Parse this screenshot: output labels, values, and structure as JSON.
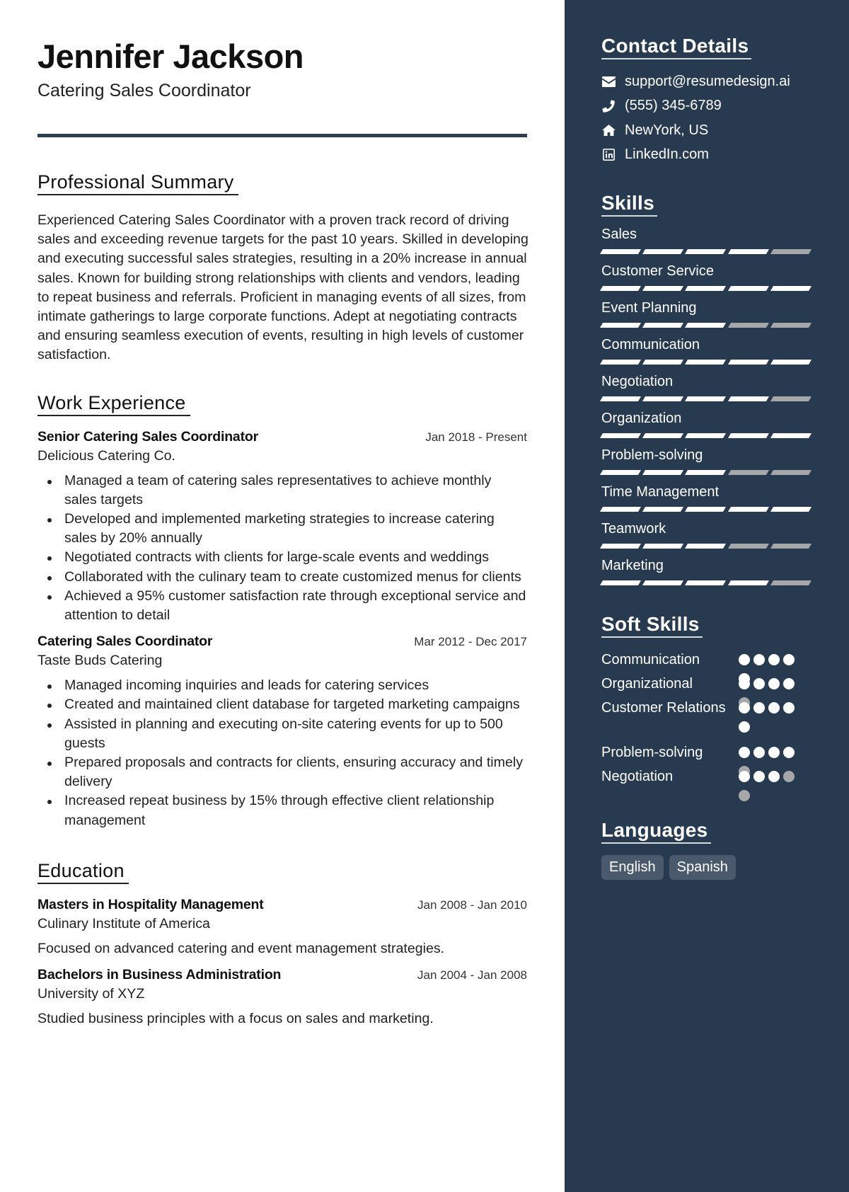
{
  "header": {
    "name": "Jennifer Jackson",
    "role": "Catering Sales Coordinator"
  },
  "summary": {
    "title": "Professional Summary",
    "text": "Experienced Catering Sales Coordinator with a proven track record of driving sales and exceeding revenue targets for the past 10 years. Skilled in developing and executing successful sales strategies, resulting in a 20% increase in annual sales. Known for building strong relationships with clients and vendors, leading to repeat business and referrals. Proficient in managing events of all sizes, from intimate gatherings to large corporate functions. Adept at negotiating contracts and ensuring seamless execution of events, resulting in high levels of customer satisfaction."
  },
  "work": {
    "title": "Work Experience",
    "jobs": [
      {
        "title": "Senior Catering Sales Coordinator",
        "dates": "Jan 2018 - Present",
        "company": "Delicious Catering Co.",
        "bullets": [
          "Managed a team of catering sales representatives to achieve monthly sales targets",
          "Developed and implemented marketing strategies to increase catering sales by 20% annually",
          "Negotiated contracts with clients for large-scale events and weddings",
          "Collaborated with the culinary team to create customized menus for clients",
          "Achieved a 95% customer satisfaction rate through exceptional service and attention to detail"
        ]
      },
      {
        "title": "Catering Sales Coordinator",
        "dates": "Mar 2012 - Dec 2017",
        "company": "Taste Buds Catering",
        "bullets": [
          "Managed incoming inquiries and leads for catering services",
          "Created and maintained client database for targeted marketing campaigns",
          "Assisted in planning and executing on-site catering events for up to 500 guests",
          "Prepared proposals and contracts for clients, ensuring accuracy and timely delivery",
          "Increased repeat business by 15% through effective client relationship management"
        ]
      }
    ]
  },
  "education": {
    "title": "Education",
    "items": [
      {
        "degree": "Masters in Hospitality Management",
        "dates": "Jan 2008 - Jan 2010",
        "school": "Culinary Institute of America",
        "desc": "Focused on advanced catering and event management strategies."
      },
      {
        "degree": "Bachelors in Business Administration",
        "dates": "Jan 2004 - Jan 2008",
        "school": "University of XYZ",
        "desc": "Studied business principles with a focus on sales and marketing."
      }
    ]
  },
  "contact": {
    "title": "Contact Details",
    "items": [
      {
        "icon": "envelope-icon",
        "text": "support@resumedesign.ai"
      },
      {
        "icon": "phone-icon",
        "text": "(555) 345-6789"
      },
      {
        "icon": "home-icon",
        "text": "NewYork, US"
      },
      {
        "icon": "linkedin-icon",
        "text": "LinkedIn.com"
      }
    ]
  },
  "skills": {
    "title": "Skills",
    "max": 5,
    "items": [
      {
        "name": "Sales",
        "level": 4
      },
      {
        "name": "Customer Service",
        "level": 5
      },
      {
        "name": "Event Planning",
        "level": 3
      },
      {
        "name": "Communication",
        "level": 5
      },
      {
        "name": "Negotiation",
        "level": 4
      },
      {
        "name": "Organization",
        "level": 5
      },
      {
        "name": "Problem-solving",
        "level": 3
      },
      {
        "name": "Time Management",
        "level": 5
      },
      {
        "name": "Teamwork",
        "level": 3
      },
      {
        "name": "Marketing",
        "level": 4
      }
    ]
  },
  "soft_skills": {
    "title": "Soft Skills",
    "max": 5,
    "items": [
      {
        "name": "Communication",
        "level": 5
      },
      {
        "name": "Organizational",
        "level": 4
      },
      {
        "name": "Customer Relations",
        "level": 5
      },
      {
        "name": "Problem-solving",
        "level": 4
      },
      {
        "name": "Negotiation",
        "level": 3
      }
    ]
  },
  "languages": {
    "title": "Languages",
    "items": [
      "English",
      "Spanish"
    ]
  },
  "colors": {
    "sidebar_bg": "#283a4f",
    "accent_divider": "#2b3e52",
    "level_on": "#ffffff",
    "level_off": "#a6a7a9",
    "chip_bg": "#4a5a6c"
  }
}
